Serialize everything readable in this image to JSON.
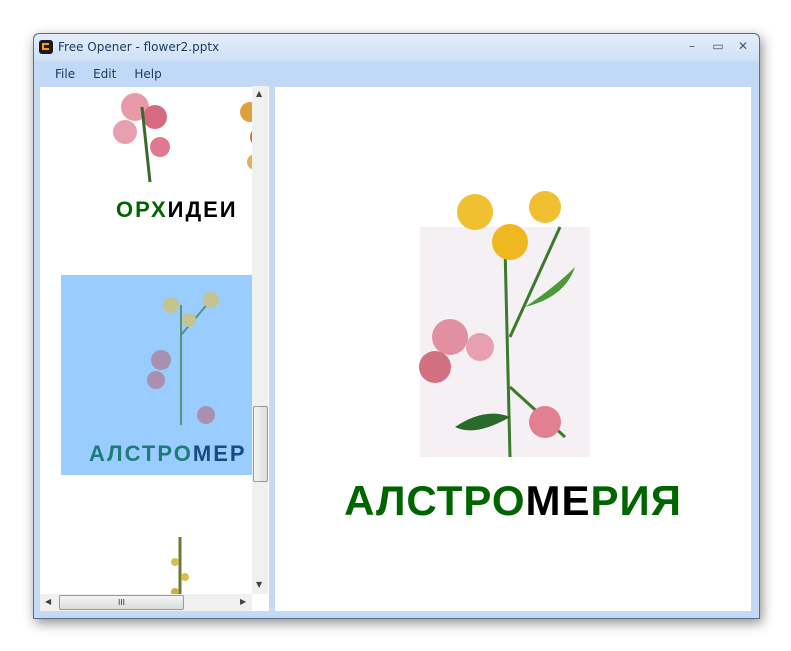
{
  "window": {
    "title": "Free Opener - flower2.pptx",
    "minimize": "–",
    "maximize": "▭",
    "close": "✕"
  },
  "menu": [
    "File",
    "Edit",
    "Help"
  ],
  "thumbnails": [
    {
      "caption_green": "ОРХ",
      "caption_black": "ИДЕИ",
      "selected": false
    },
    {
      "caption_green": "АЛСТРО",
      "caption_black": "МЕР",
      "selected": true
    },
    {
      "caption_green": "",
      "caption_black": "",
      "selected": false
    }
  ],
  "slide": {
    "caption_part1": "АЛСТРО",
    "caption_part2": "МЕ",
    "caption_part3": "РИЯ"
  },
  "colors": {
    "green": "#006400",
    "black": "#000000",
    "selection": "#99ccff"
  },
  "scrollbar": {
    "grip": "III"
  }
}
